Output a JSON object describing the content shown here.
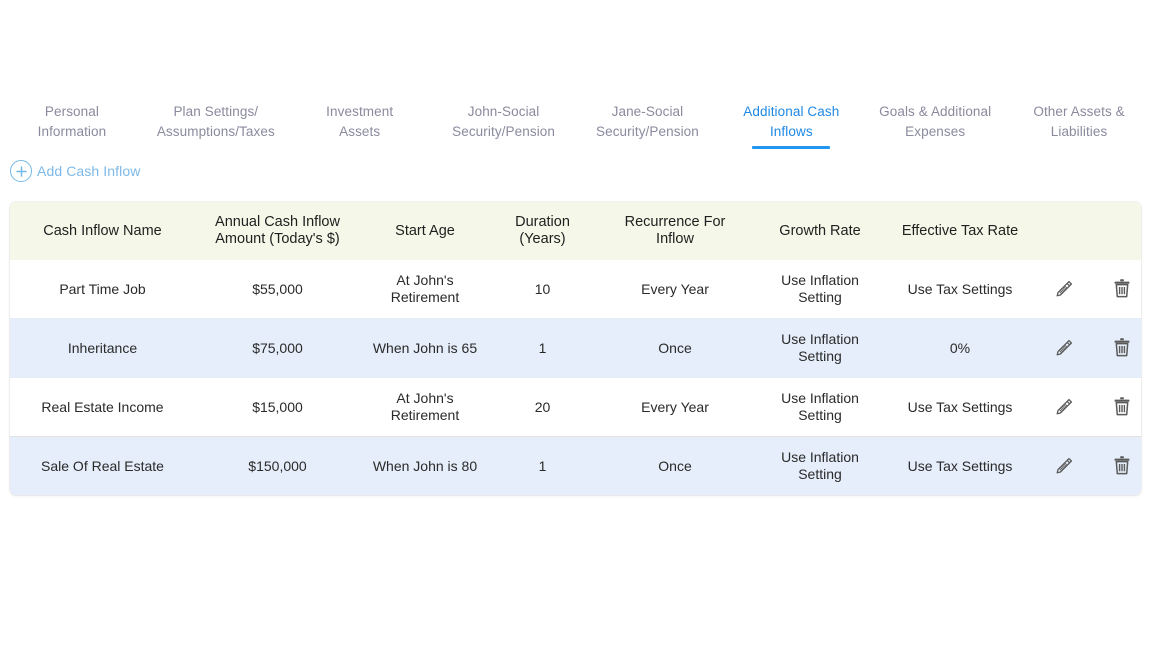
{
  "tabs": [
    {
      "id": "personal-information",
      "lines": [
        "Personal",
        "Information"
      ],
      "active": false
    },
    {
      "id": "plan-settings-assumptions-taxes",
      "lines": [
        "Plan Settings/",
        "Assumptions/Taxes"
      ],
      "active": false
    },
    {
      "id": "investment-assets",
      "lines": [
        "Investment",
        "Assets"
      ],
      "active": false
    },
    {
      "id": "john-social-security-pension",
      "lines": [
        "John-Social",
        "Security/Pension"
      ],
      "active": false
    },
    {
      "id": "jane-social-security-pension",
      "lines": [
        "Jane-Social",
        "Security/Pension"
      ],
      "active": false
    },
    {
      "id": "additional-cash-inflows",
      "lines": [
        "Additional Cash",
        "Inflows"
      ],
      "active": true
    },
    {
      "id": "goals-additional-expenses",
      "lines": [
        "Goals & Additional",
        "Expenses"
      ],
      "active": false
    },
    {
      "id": "other-assets-liabilities",
      "lines": [
        "Other Assets &",
        "Liabilities"
      ],
      "active": false
    }
  ],
  "toolbar": {
    "add_label": "Add Cash Inflow",
    "add_icon": "plus-circle-icon"
  },
  "table": {
    "columns": [
      {
        "key": "name",
        "label": "Cash Inflow Name"
      },
      {
        "key": "amount",
        "label": "Annual Cash Inflow Amount (Today's $)"
      },
      {
        "key": "startAge",
        "label": "Start Age"
      },
      {
        "key": "duration",
        "label": "Duration (Years)"
      },
      {
        "key": "recurrence",
        "label": "Recurrence For Inflow"
      },
      {
        "key": "growth",
        "label": "Growth Rate"
      },
      {
        "key": "tax",
        "label": "Effective Tax Rate"
      },
      {
        "key": "edit",
        "label": ""
      },
      {
        "key": "delete",
        "label": ""
      }
    ],
    "column_labels_multiline": {
      "amount": [
        "Annual Cash Inflow",
        "Amount (Today's $)"
      ],
      "duration": [
        "Duration",
        "(Years)"
      ],
      "recurrence": [
        "Recurrence For",
        "Inflow"
      ]
    },
    "rows": [
      {
        "name": "Part Time Job",
        "amount": "$55,000",
        "startAge": [
          "At John's",
          "Retirement"
        ],
        "duration": "10",
        "recurrence": "Every Year",
        "growth": [
          "Use Inflation",
          "Setting"
        ],
        "tax": "Use Tax Settings",
        "edit_icon": "pencil-icon",
        "delete_icon": "trash-icon"
      },
      {
        "name": "Inheritance",
        "amount": "$75,000",
        "startAge": [
          "When John is 65"
        ],
        "duration": "1",
        "recurrence": "Once",
        "growth": [
          "Use Inflation",
          "Setting"
        ],
        "tax": "0%",
        "edit_icon": "pencil-icon",
        "delete_icon": "trash-icon"
      },
      {
        "name": "Real Estate Income",
        "amount": "$15,000",
        "startAge": [
          "At John's",
          "Retirement"
        ],
        "duration": "20",
        "recurrence": "Every Year",
        "growth": [
          "Use Inflation",
          "Setting"
        ],
        "tax": "Use Tax Settings",
        "edit_icon": "pencil-icon",
        "delete_icon": "trash-icon"
      },
      {
        "name": "Sale Of Real Estate",
        "amount": "$150,000",
        "startAge": [
          "When John is 80"
        ],
        "duration": "1",
        "recurrence": "Once",
        "growth": [
          "Use Inflation",
          "Setting"
        ],
        "tax": "Use Tax Settings",
        "edit_icon": "pencil-icon",
        "delete_icon": "trash-icon"
      }
    ]
  },
  "colors": {
    "tab_active": "#1e88e5",
    "tab_underline": "#2196f3",
    "tab_inactive": "#8a8a9e",
    "add_link": "#7cb9e8",
    "header_bg": "#f5f7e8",
    "row_alt_bg": "#e5eefa",
    "icon": "#5a5a5a"
  }
}
